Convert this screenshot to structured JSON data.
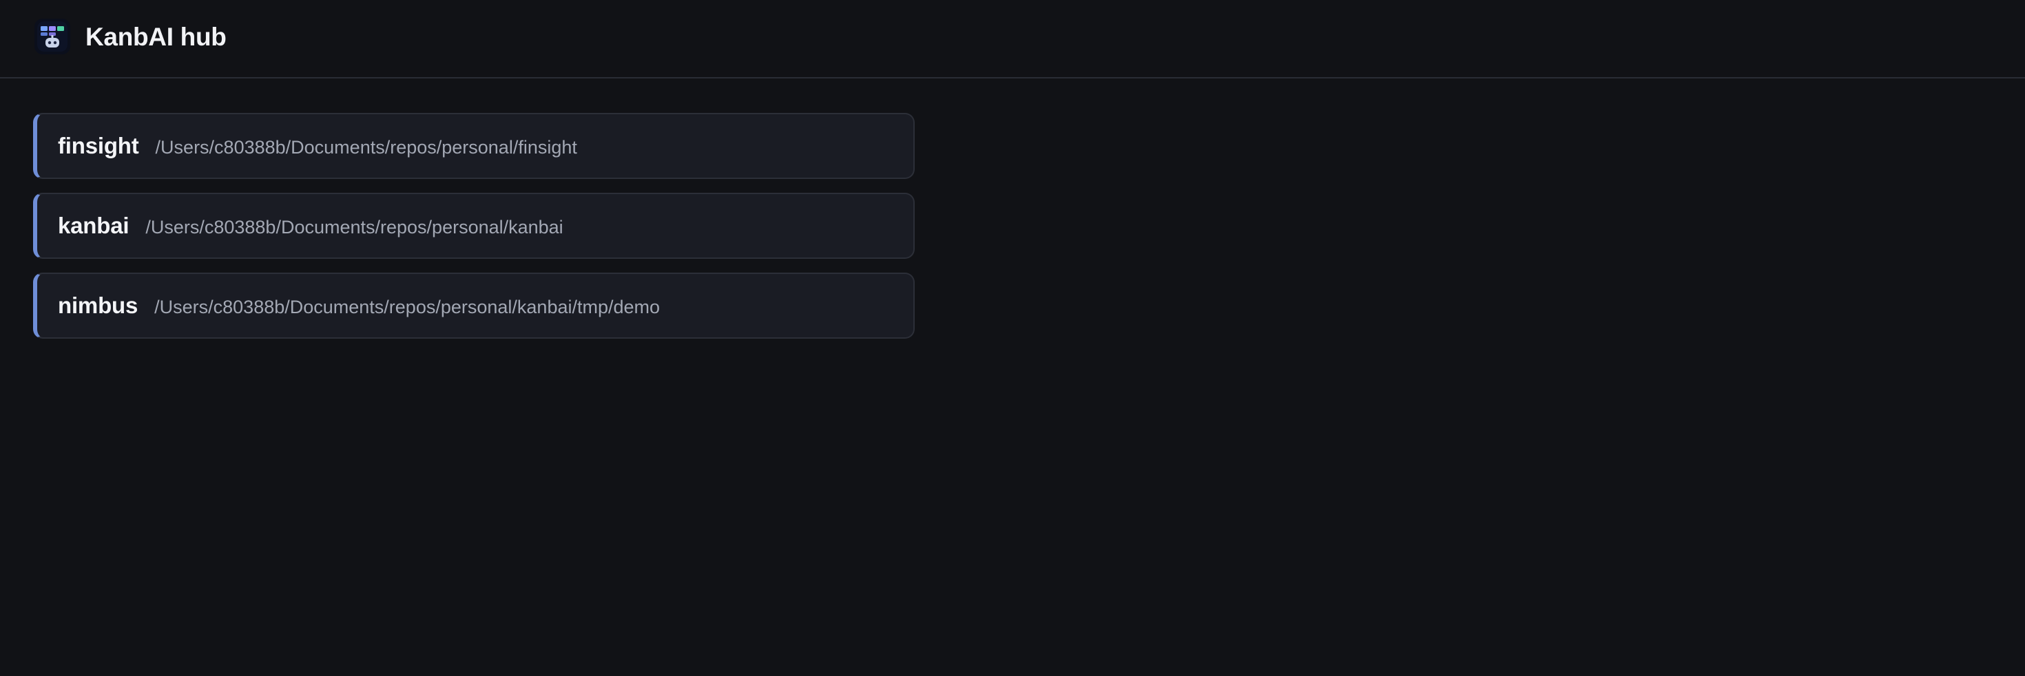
{
  "app": {
    "title": "KanbAI hub",
    "logo_icon": "kanban-robot-logo-icon"
  },
  "colors": {
    "background": "#111216",
    "card_background": "#1a1c24",
    "card_border": "#2c2f38",
    "accent": "#6f8ed8",
    "text_primary": "#f4f5f8",
    "text_secondary": "#a3a8b4"
  },
  "projects": [
    {
      "name": "finsight",
      "path": "/Users/c80388b/Documents/repos/personal/finsight"
    },
    {
      "name": "kanbai",
      "path": "/Users/c80388b/Documents/repos/personal/kanbai"
    },
    {
      "name": "nimbus",
      "path": "/Users/c80388b/Documents/repos/personal/kanbai/tmp/demo"
    }
  ]
}
